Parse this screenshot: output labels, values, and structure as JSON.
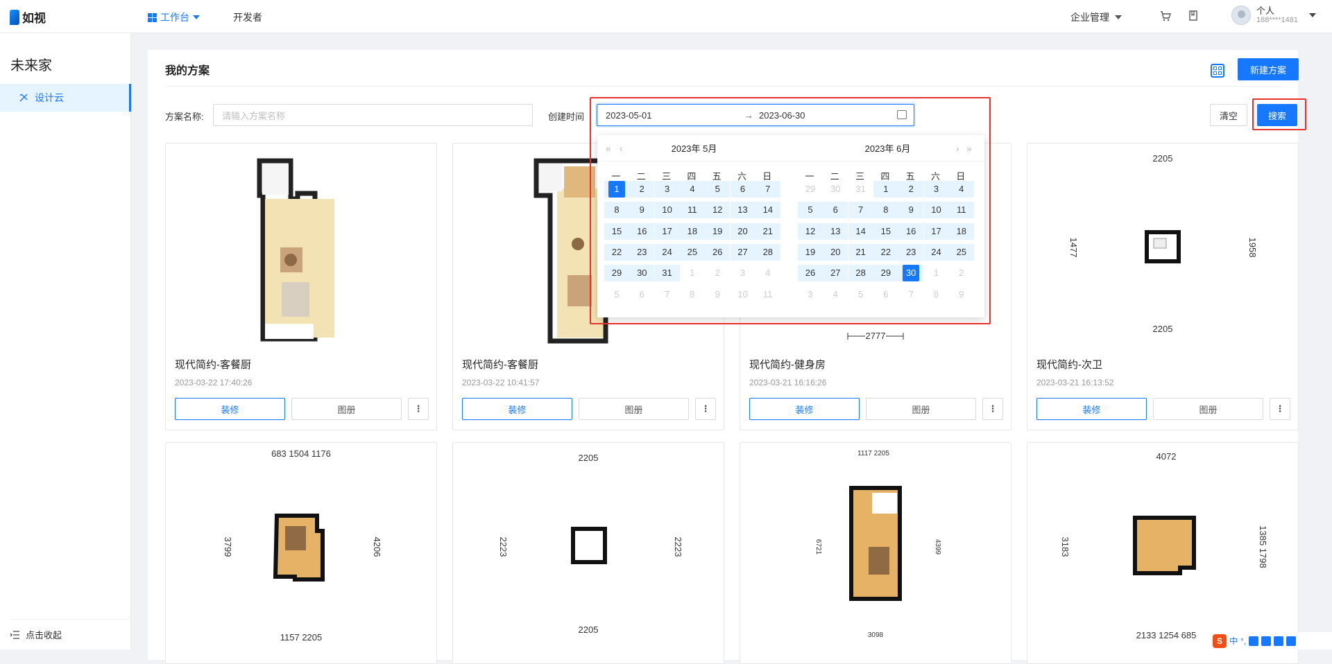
{
  "app": {
    "name": "如视"
  },
  "topnav": {
    "workbench": "工作台",
    "developer": "开发者",
    "enterprise": "企业管理"
  },
  "user": {
    "name": "个人",
    "phone": "188****1481"
  },
  "sidebar": {
    "title": "未来家",
    "items": [
      {
        "label": "设计云"
      }
    ],
    "collapse": "点击收起"
  },
  "page": {
    "title": "我的方案",
    "new_button": "新建方案"
  },
  "filters": {
    "name_label": "方案名称:",
    "name_placeholder": "请输入方案名称",
    "time_label": "创建时间",
    "start_date": "2023-05-01",
    "range_arrow": "→",
    "end_date": "2023-06-30",
    "clear": "清空",
    "search": "搜索"
  },
  "calendar": {
    "weekdays": [
      "一",
      "二",
      "三",
      "四",
      "五",
      "六",
      "日"
    ],
    "left": {
      "title": "2023年  5月"
    },
    "right": {
      "title": "2023年  6月"
    }
  },
  "plans": [
    {
      "name": "现代简约-客餐厨",
      "date": "2023-03-22 17:40:26"
    },
    {
      "name": "现代简约-客餐厨",
      "date": "2023-03-22 10:41:57"
    },
    {
      "name": "现代简约-健身房",
      "date": "2023-03-21 16:16:26"
    },
    {
      "name": "现代简约-次卫",
      "date": "2023-03-21 16:13:52"
    }
  ],
  "plan_buttons": {
    "decorate": "装修",
    "album": "图册",
    "more": "⋮"
  },
  "thumbs": {
    "t3_bottom": "2777",
    "t4": {
      "top": "2205",
      "left": "1477",
      "right": "1958",
      "bottom": "2205"
    },
    "r2_1": {
      "top": "683 1504 1176",
      "left": "3799",
      "right": "4206",
      "bottom": "1157 2205"
    },
    "r2_2": {
      "top": "2205",
      "left": "2223",
      "right": "2223",
      "bottom": "2205"
    },
    "r2_3": {
      "top": "1117 2205",
      "left": "6721",
      "right": "4399",
      "bottom": "3098"
    },
    "r2_4": {
      "top": "4072",
      "left": "3183",
      "right": "1385 1798",
      "bottom": "2133 1254 685"
    }
  },
  "ime": {
    "lang": "中",
    "punct": "°,"
  },
  "colors": {
    "primary": "#1677ff",
    "highlight_box": "#e8302a",
    "range_bg": "#e6f4ff"
  }
}
